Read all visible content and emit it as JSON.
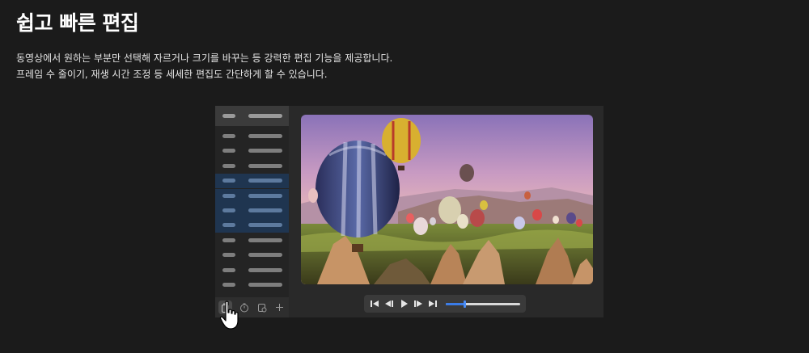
{
  "heading": {
    "title": "쉽고 빠른 편집",
    "line1": "동영상에서 원하는 부분만 선택해 자르거나 크기를 바꾸는 등 강력한 편집 기능을 제공합니다.",
    "line2": "프레임 수 줄이기, 재생 시간 조정 등 세세한 편집도 간단하게 할 수 있습니다."
  },
  "editor": {
    "frame_count": 11,
    "selected_frames": [
      3,
      4,
      5,
      6
    ],
    "sidebar_tools": [
      "delete-frame-icon",
      "timer-icon",
      "frame-duration-icon",
      "add-icon"
    ],
    "active_tool": "delete-frame-icon",
    "playback_controls": [
      "skip-to-start-icon",
      "step-back-icon",
      "play-icon",
      "step-forward-icon",
      "skip-to-end-icon"
    ],
    "playback_progress": 0.25,
    "preview_image": "hot-air-balloons-over-valley",
    "colors": {
      "accent": "#3a7ce8",
      "selection": "#1f3550",
      "background": "#1b1b1b"
    }
  }
}
